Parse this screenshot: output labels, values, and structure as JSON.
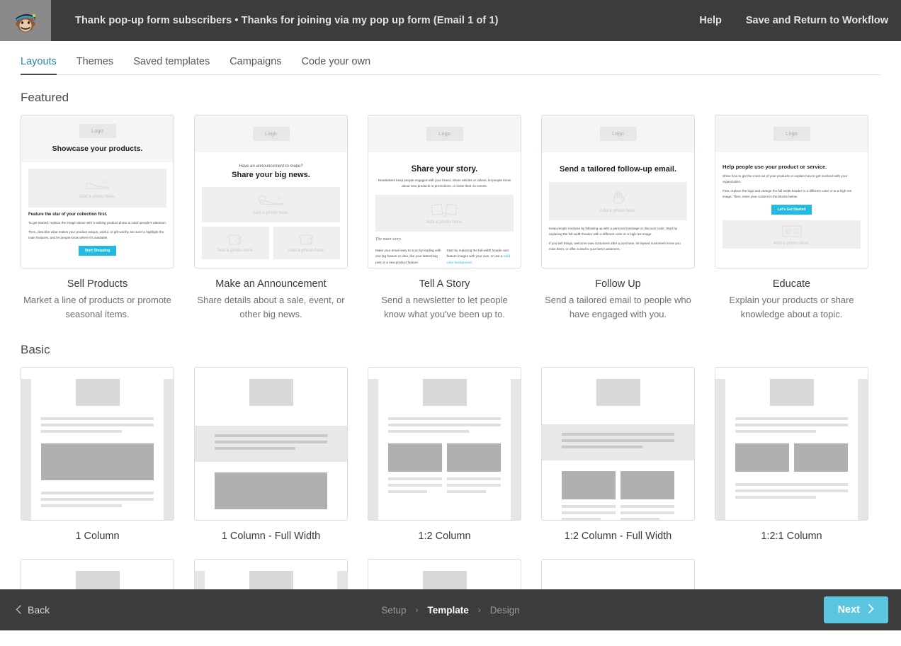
{
  "header": {
    "logo_icon": "mailchimp-freddie-icon",
    "title": "Thank pop-up form subscribers • Thanks for joining via my pop up form (Email 1 of 1)",
    "help_label": "Help",
    "save_label": "Save and Return to Workflow"
  },
  "tabs": [
    {
      "label": "Layouts",
      "active": true
    },
    {
      "label": "Themes",
      "active": false
    },
    {
      "label": "Saved templates",
      "active": false
    },
    {
      "label": "Campaigns",
      "active": false
    },
    {
      "label": "Code your own",
      "active": false
    }
  ],
  "featured": {
    "section_label": "Featured",
    "cards": [
      {
        "title": "Sell Products",
        "desc": "Market a line of products or promote seasonal items.",
        "logo": "Logo",
        "headline": "Showcase your products.",
        "photo_caption": "Add a photo here.",
        "sub_headline": "Feature the star of your collection first.",
        "para1": "To get started, replace the image above with a striking product photo to catch people's attention.",
        "para2": "Then, describe what makes your product unique, useful, or gift-worthy. Be sure to highlight the main features, and let people know where it's available.",
        "button": "Start Shopping"
      },
      {
        "title": "Make an Announcement",
        "desc": "Share details about a sale, event, or other big news.",
        "logo": "Logo",
        "eyebrow": "Have an announcement to make?",
        "headline": "Share your big news.",
        "photo_caption": "Add a photo here.",
        "photo_caption_left": "Add a photo here.",
        "photo_caption_right": "Add a photo here."
      },
      {
        "title": "Tell A Story",
        "desc": "Send a newsletter to let people know what you've been up to.",
        "logo": "Logo",
        "headline": "Share your story.",
        "para1": "Newsletters keep people engaged with your brand. Share articles or videos, let people know about new products or promotions, or invite them to events.",
        "photo_caption": "Add a photo here.",
        "sub_headline": "The main story.",
        "col_left": "Make your email easy to scan by leading with one big feature or idea, like your latest blog post or a new product feature.",
        "col_right": "Start by replacing the full-width header and feature images with your own, or use a",
        "col_right_link": "solid color background"
      },
      {
        "title": "Follow Up",
        "desc": "Send a tailored email to people who have engaged with you.",
        "logo": "Logo",
        "headline": "Send a tailored follow-up email.",
        "photo_caption": "Add a photo here.",
        "para1": "Keep people involved by following up with a personal message or discount code. Start by replacing the full-width header with a different color or a high-res image.",
        "para2": "If you sell things, welcome new customers after a purchase, let lapsed customers know you miss them, or offer a deal to your best customers."
      },
      {
        "title": "Educate",
        "desc": "Explain your products or share knowledge about a topic.",
        "logo": "Logo",
        "headline": "Help people use your product or service.",
        "para1": "Show how to get the most out of your products or explain how to get involved with your organization.",
        "para2": "First, replace the logo and change the full-width header to a different color or to a high-res image. Then, enter your content in the blocks below.",
        "button": "Let's Get Started",
        "photo_caption": "Add a photo here."
      }
    ]
  },
  "basic": {
    "section_label": "Basic",
    "cards": [
      {
        "title": "1 Column",
        "style": "padded"
      },
      {
        "title": "1 Column - Full Width",
        "style": "full"
      },
      {
        "title": "1:2 Column",
        "style": "padded"
      },
      {
        "title": "1:2 Column - Full Width",
        "style": "full"
      },
      {
        "title": "1:2:1 Column",
        "style": "padded"
      }
    ]
  },
  "footer": {
    "back_label": "Back",
    "back_icon": "chevron-left-icon",
    "crumbs": [
      {
        "label": "Setup",
        "current": false
      },
      {
        "label": "Template",
        "current": true
      },
      {
        "label": "Design",
        "current": false
      }
    ],
    "crumb_separator": "›",
    "next_label": "Next",
    "next_icon": "chevron-right-icon"
  },
  "colors": {
    "header_bg": "#3c3c3c",
    "accent_tab": "#2b8a9b",
    "email_button": "#21bae0",
    "next_button": "#5cc6e0"
  }
}
